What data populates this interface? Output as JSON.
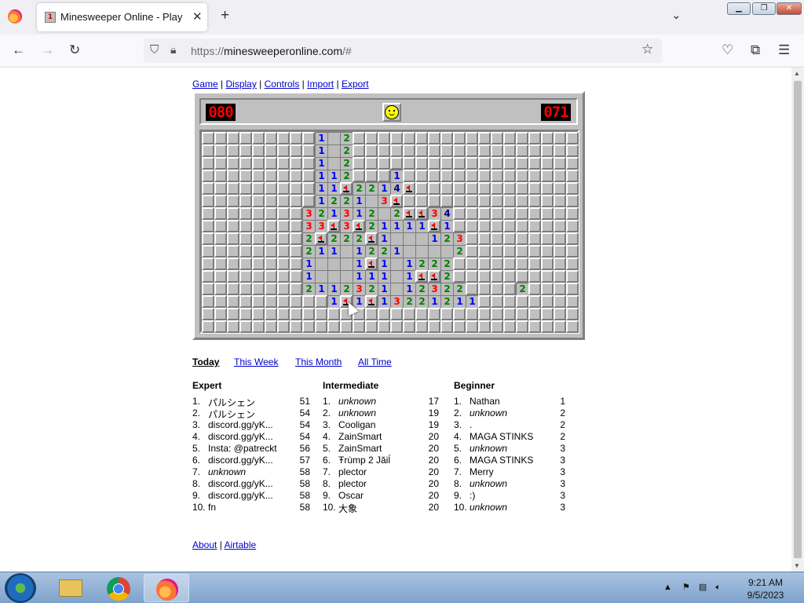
{
  "browser": {
    "tab_title": "Minesweeper Online - Play Free",
    "tab_favicon_digit": "1",
    "url_prefix": "https://",
    "url_main": "minesweeperonline.com",
    "url_suffix": "/#"
  },
  "menu": {
    "items": [
      "Game",
      "Display",
      "Controls",
      "Import",
      "Export"
    ],
    "separator": " | "
  },
  "game": {
    "mine_counter": "080",
    "timer": "071",
    "state_face": "smiley",
    "rows": 16,
    "cols": 30,
    "board": [
      "#########1_2##################",
      "#########1_2##################",
      "#########1_2##################",
      "#########112###1##############",
      "#########11F2214F#############",
      "#########1221_3F##############",
      "########321312_2FF34##########",
      "########33F3F21111F1##########",
      "########2F222F1___123#########",
      "########211_1221____2#########",
      "########1___1F1_1222##########",
      "########1___111_1FF2##########",
      "########2112321_12322####2####",
      "##########1F1F13221211########",
      "##############################",
      "##############################"
    ],
    "number_colors": {
      "1": "#0000ff",
      "2": "#008000",
      "3": "#ff0000",
      "4": "#000080"
    }
  },
  "leaderboard": {
    "timeframes": [
      "Today",
      "This Week",
      "This Month",
      "All Time"
    ],
    "active_timeframe": "Today",
    "columns": [
      {
        "title": "Expert",
        "rows": [
          {
            "rank": "1.",
            "name": "パルシェン",
            "time": "51",
            "italic": false
          },
          {
            "rank": "2.",
            "name": "パルシェン",
            "time": "54",
            "italic": false
          },
          {
            "rank": "3.",
            "name": "discord.gg/yK...",
            "time": "54",
            "italic": false
          },
          {
            "rank": "4.",
            "name": "discord.gg/yK...",
            "time": "54",
            "italic": false
          },
          {
            "rank": "5.",
            "name": "Insta: @patreckt",
            "time": "56",
            "italic": false
          },
          {
            "rank": "6.",
            "name": "discord.gg/yK...",
            "time": "57",
            "italic": false
          },
          {
            "rank": "7.",
            "name": "unknown",
            "time": "58",
            "italic": true
          },
          {
            "rank": "8.",
            "name": "discord.gg/yK...",
            "time": "58",
            "italic": false
          },
          {
            "rank": "9.",
            "name": "discord.gg/yK...",
            "time": "58",
            "italic": false
          },
          {
            "rank": "10.",
            "name": "fn",
            "time": "58",
            "italic": false
          }
        ]
      },
      {
        "title": "Intermediate",
        "rows": [
          {
            "rank": "1.",
            "name": "unknown",
            "time": "17",
            "italic": true
          },
          {
            "rank": "2.",
            "name": "unknown",
            "time": "19",
            "italic": true
          },
          {
            "rank": "3.",
            "name": "Cooligan",
            "time": "19",
            "italic": false
          },
          {
            "rank": "4.",
            "name": "ZainSmart",
            "time": "20",
            "italic": false
          },
          {
            "rank": "5.",
            "name": "ZainSmart",
            "time": "20",
            "italic": false
          },
          {
            "rank": "6.",
            "name": "Ŧrùmp 2 Jăiĺ",
            "time": "20",
            "italic": false
          },
          {
            "rank": "7.",
            "name": "plector",
            "time": "20",
            "italic": false
          },
          {
            "rank": "8.",
            "name": "plector",
            "time": "20",
            "italic": false
          },
          {
            "rank": "9.",
            "name": "Oscar",
            "time": "20",
            "italic": false
          },
          {
            "rank": "10.",
            "name": "大象",
            "time": "20",
            "italic": false
          }
        ]
      },
      {
        "title": "Beginner",
        "rows": [
          {
            "rank": "1.",
            "name": "Nathan",
            "time": "1",
            "italic": false
          },
          {
            "rank": "2.",
            "name": "unknown",
            "time": "2",
            "italic": true
          },
          {
            "rank": "3.",
            "name": ".",
            "time": "2",
            "italic": false
          },
          {
            "rank": "4.",
            "name": "MAGA STINKS",
            "time": "2",
            "italic": false
          },
          {
            "rank": "5.",
            "name": "unknown",
            "time": "3",
            "italic": true
          },
          {
            "rank": "6.",
            "name": "MAGA STINKS",
            "time": "3",
            "italic": false
          },
          {
            "rank": "7.",
            "name": "Merry",
            "time": "3",
            "italic": false
          },
          {
            "rank": "8.",
            "name": "unknown",
            "time": "3",
            "italic": true
          },
          {
            "rank": "9.",
            "name": ":)",
            "time": "3",
            "italic": false
          },
          {
            "rank": "10.",
            "name": "unknown",
            "time": "3",
            "italic": true
          }
        ]
      }
    ]
  },
  "footer": {
    "links": [
      "About",
      "Airtable"
    ],
    "separator": " | "
  },
  "taskbar": {
    "apps": [
      "file-explorer-icon",
      "chrome-icon",
      "firefox-icon"
    ],
    "active_app": "firefox-icon",
    "time": "9:21 AM",
    "date": "9/5/2023"
  }
}
